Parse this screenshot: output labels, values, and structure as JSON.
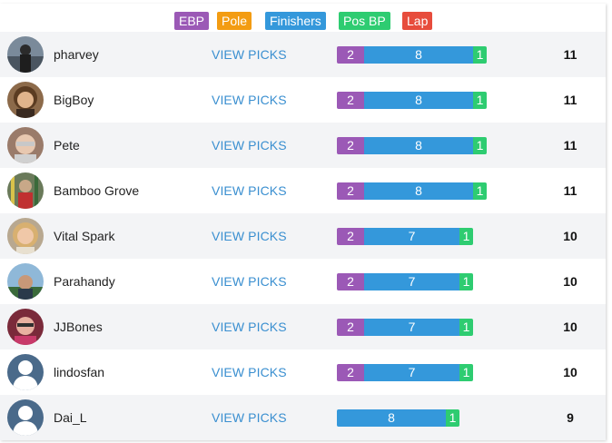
{
  "legend": [
    {
      "label": "EBP",
      "color": "#9b59b6"
    },
    {
      "label": "Pole",
      "color": "#f39c12"
    },
    {
      "label": "Finishers",
      "color": "#3498db"
    },
    {
      "label": "Pos BP",
      "color": "#2ecc71"
    },
    {
      "label": "Lap",
      "color": "#e74c3c"
    }
  ],
  "view_label": "VIEW PICKS",
  "rows": [
    {
      "name": "pharvey",
      "avatar": "photo-icon",
      "ebp": "2",
      "fin": "8",
      "pos": "1",
      "total": "11"
    },
    {
      "name": "BigBoy",
      "avatar": "photo-icon",
      "ebp": "2",
      "fin": "8",
      "pos": "1",
      "total": "11"
    },
    {
      "name": "Pete",
      "avatar": "photo-icon",
      "ebp": "2",
      "fin": "8",
      "pos": "1",
      "total": "11"
    },
    {
      "name": "Bamboo Grove",
      "avatar": "photo-icon",
      "ebp": "2",
      "fin": "8",
      "pos": "1",
      "total": "11"
    },
    {
      "name": "Vital Spark",
      "avatar": "photo-icon",
      "ebp": "2",
      "fin": "7",
      "pos": "1",
      "total": "10"
    },
    {
      "name": "Parahandy",
      "avatar": "photo-icon",
      "ebp": "2",
      "fin": "7",
      "pos": "1",
      "total": "10"
    },
    {
      "name": "JJBones",
      "avatar": "photo-icon",
      "ebp": "2",
      "fin": "7",
      "pos": "1",
      "total": "10"
    },
    {
      "name": "lindosfan",
      "avatar": "default-user-icon",
      "ebp": "2",
      "fin": "7",
      "pos": "1",
      "total": "10"
    },
    {
      "name": "Dai_L",
      "avatar": "default-user-icon",
      "ebp": "",
      "fin": "8",
      "pos": "1",
      "total": "9"
    }
  ]
}
